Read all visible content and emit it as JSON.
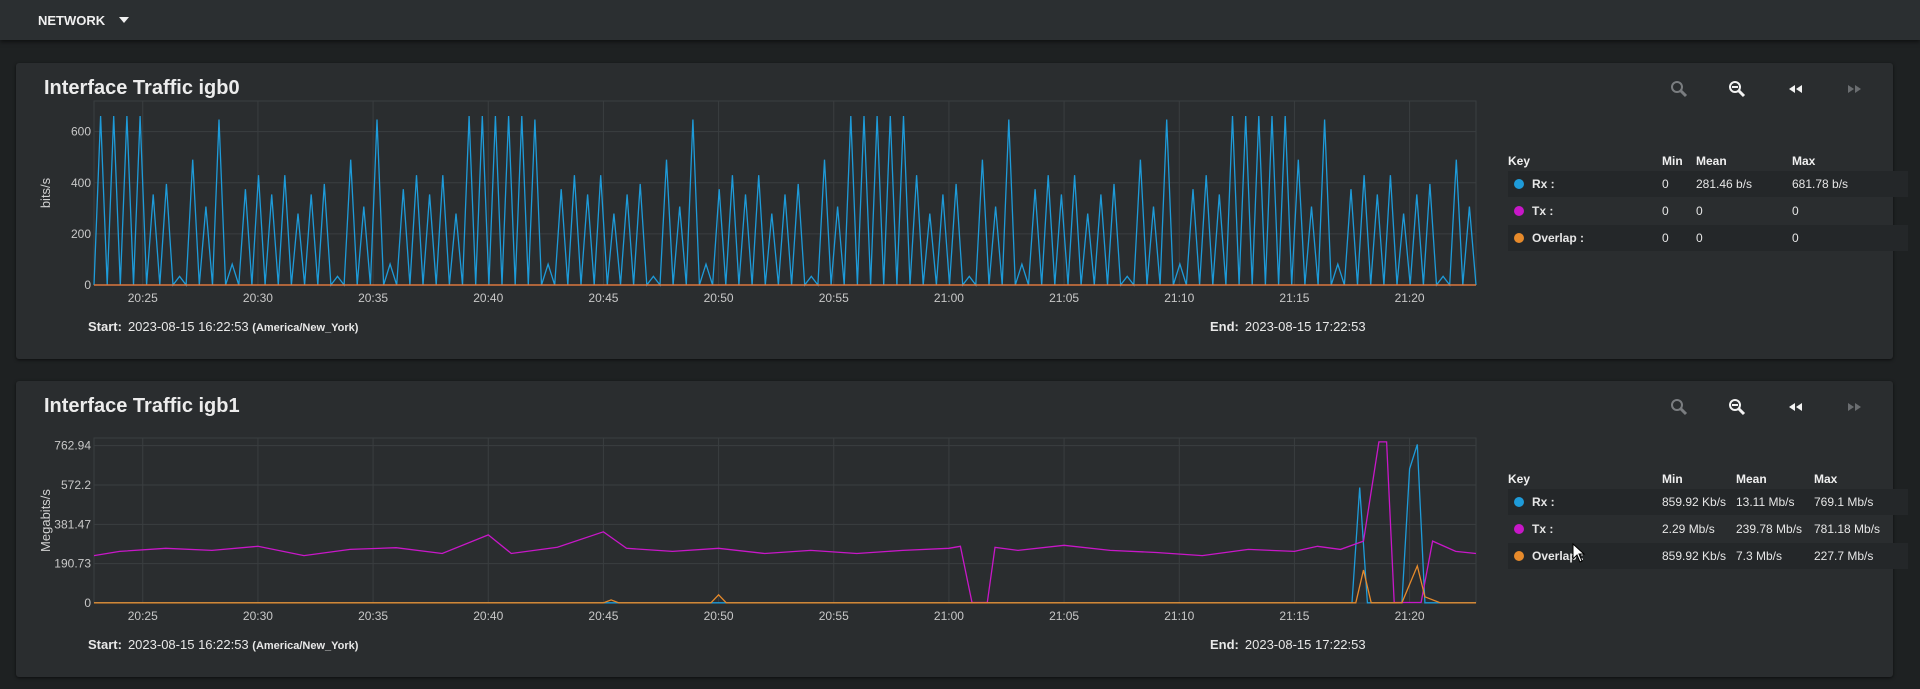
{
  "topbar": {
    "menu_label": "NETWORK"
  },
  "icons": {
    "zoom_in": "zoom-in-icon",
    "zoom_out": "zoom-out-icon",
    "back": "rewind-icon",
    "forward": "fast-forward-icon",
    "dropdown": "caret-down-icon"
  },
  "colors": {
    "rx": "#1e9bd9",
    "tx": "#c817c8",
    "overlap": "#e68a2b",
    "card": "#2a2d2f",
    "page": "#1e2122"
  },
  "panels": [
    {
      "title": "Interface Traffic igb0",
      "ylabel": "bits/s",
      "start_label": "Start:",
      "start_value": "2023-08-15 16:22:53",
      "start_tz": "(America/New_York)",
      "end_label": "End:",
      "end_value": "2023-08-15 17:22:53",
      "legend": {
        "headers": [
          "Key",
          "Min",
          "Mean",
          "Max"
        ],
        "rows": [
          {
            "name": "Rx :",
            "min": "0",
            "mean": "281.46 b/s",
            "max": "681.78 b/s"
          },
          {
            "name": "Tx :",
            "min": "0",
            "mean": "0",
            "max": "0"
          },
          {
            "name": "Overlap :",
            "min": "0",
            "mean": "0",
            "max": "0"
          }
        ]
      }
    },
    {
      "title": "Interface Traffic igb1",
      "ylabel": "Megabits/s",
      "start_label": "Start:",
      "start_value": "2023-08-15 16:22:53",
      "start_tz": "(America/New_York)",
      "end_label": "End:",
      "end_value": "2023-08-15 17:22:53",
      "legend": {
        "headers": [
          "Key",
          "Min",
          "Mean",
          "Max"
        ],
        "rows": [
          {
            "name": "Rx :",
            "min": "859.92 Kb/s",
            "mean": "13.11 Mb/s",
            "max": "769.1 Mb/s"
          },
          {
            "name": "Tx :",
            "min": "2.29 Mb/s",
            "mean": "239.78 Mb/s",
            "max": "781.18 Mb/s"
          },
          {
            "name": "Overlap :",
            "min": "859.92 Kb/s",
            "mean": "7.3 Mb/s",
            "max": "227.7 Mb/s"
          }
        ]
      }
    }
  ],
  "chart_data": [
    {
      "type": "line",
      "title": "Interface Traffic igb0",
      "ylabel": "bits/s",
      "xlabel": "",
      "xticks": [
        "20:25",
        "20:30",
        "20:35",
        "20:40",
        "20:45",
        "20:50",
        "20:55",
        "21:00",
        "21:05",
        "21:10",
        "21:15",
        "21:20"
      ],
      "xlim": [
        "20:22:53",
        "21:22:53"
      ],
      "yticks": [
        0,
        200,
        400,
        600
      ],
      "ylim": [
        0,
        720
      ],
      "grid": true,
      "series": [
        {
          "name": "Rx",
          "color": "#1e9bd9",
          "pattern": "sawtooth",
          "min": 0,
          "mean": 281.46,
          "max": 681.78
        },
        {
          "name": "Tx",
          "color": "#c817c8",
          "constant": 0
        },
        {
          "name": "Overlap",
          "color": "#e68a2b",
          "constant": 0
        }
      ]
    },
    {
      "type": "line",
      "title": "Interface Traffic igb1",
      "ylabel": "Megabits/s",
      "xlabel": "",
      "xticks": [
        "20:25",
        "20:30",
        "20:35",
        "20:40",
        "20:45",
        "20:50",
        "20:55",
        "21:00",
        "21:05",
        "21:10",
        "21:15",
        "21:20"
      ],
      "xlim": [
        "20:22:53",
        "21:22:53"
      ],
      "yticks": [
        0,
        190.73,
        381.47,
        572.2,
        762.94
      ],
      "ylim": [
        0,
        800
      ],
      "grid": true,
      "series": [
        {
          "name": "Rx",
          "color": "#1e9bd9",
          "points": [
            [
              "20:22:53",
              0.9
            ],
            [
              "21:17:30",
              0.9
            ],
            [
              "21:17:50",
              560
            ],
            [
              "21:18:10",
              0.9
            ],
            [
              "21:19:40",
              0.9
            ],
            [
              "21:20:00",
              650
            ],
            [
              "21:20:20",
              769.1
            ],
            [
              "21:20:40",
              0.9
            ],
            [
              "21:22:53",
              0.9
            ]
          ]
        },
        {
          "name": "Tx",
          "color": "#c817c8",
          "points": [
            [
              "20:22:53",
              230
            ],
            [
              "20:24",
              250
            ],
            [
              "20:26",
              265
            ],
            [
              "20:28",
              255
            ],
            [
              "20:30",
              275
            ],
            [
              "20:32",
              230
            ],
            [
              "20:34",
              260
            ],
            [
              "20:36",
              268
            ],
            [
              "20:38",
              240
            ],
            [
              "20:40",
              330
            ],
            [
              "20:41",
              240
            ],
            [
              "20:43",
              270
            ],
            [
              "20:45",
              345
            ],
            [
              "20:46",
              265
            ],
            [
              "20:48",
              250
            ],
            [
              "20:50",
              265
            ],
            [
              "20:52",
              240
            ],
            [
              "20:54",
              255
            ],
            [
              "20:56",
              240
            ],
            [
              "20:58",
              255
            ],
            [
              "21:00",
              265
            ],
            [
              "21:00:30",
              275
            ],
            [
              "21:01",
              2.3
            ],
            [
              "21:01:40",
              2.3
            ],
            [
              "21:02",
              270
            ],
            [
              "21:03",
              255
            ],
            [
              "21:05",
              280
            ],
            [
              "21:07",
              255
            ],
            [
              "21:09",
              245
            ],
            [
              "21:11",
              230
            ],
            [
              "21:13",
              260
            ],
            [
              "21:15",
              250
            ],
            [
              "21:16",
              275
            ],
            [
              "21:17",
              260
            ],
            [
              "21:18",
              300
            ],
            [
              "21:18:40",
              781.18
            ],
            [
              "21:19",
              781.18
            ],
            [
              "21:19:20",
              2.3
            ],
            [
              "21:20:30",
              2.3
            ],
            [
              "21:21",
              300
            ],
            [
              "21:22",
              250
            ],
            [
              "21:22:53",
              240
            ]
          ]
        },
        {
          "name": "Overlap",
          "color": "#e68a2b",
          "points": [
            [
              "20:22:53",
              0.9
            ],
            [
              "20:45",
              0.9
            ],
            [
              "20:45:20",
              15
            ],
            [
              "20:45:40",
              0.9
            ],
            [
              "20:49:40",
              0.9
            ],
            [
              "20:50",
              40
            ],
            [
              "20:50:20",
              0.9
            ],
            [
              "21:17:40",
              0.9
            ],
            [
              "21:18",
              160
            ],
            [
              "21:18:20",
              0.9
            ],
            [
              "21:19:40",
              0.9
            ],
            [
              "21:20",
              90
            ],
            [
              "21:20:20",
              180
            ],
            [
              "21:20:40",
              30
            ],
            [
              "21:21:20",
              0.9
            ],
            [
              "21:22:53",
              0.9
            ]
          ]
        }
      ]
    }
  ]
}
